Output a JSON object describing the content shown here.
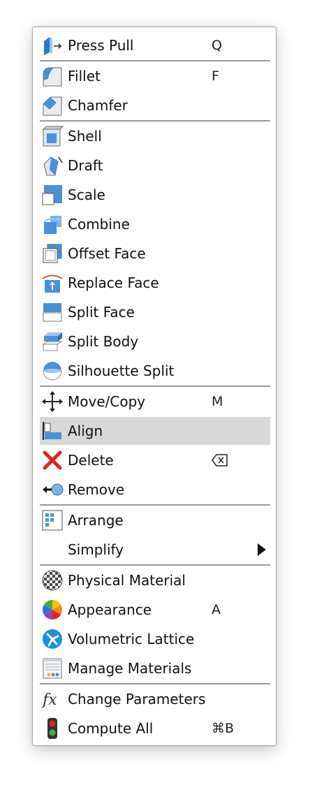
{
  "menu": {
    "items": [
      {
        "label": "Press Pull",
        "shortcut": "Q",
        "icon": "press-pull-icon"
      },
      {
        "label": "Fillet",
        "shortcut": "F",
        "icon": "fillet-icon"
      },
      {
        "label": "Chamfer",
        "icon": "chamfer-icon"
      },
      {
        "label": "Shell",
        "icon": "shell-icon"
      },
      {
        "label": "Draft",
        "icon": "draft-icon"
      },
      {
        "label": "Scale",
        "icon": "scale-icon"
      },
      {
        "label": "Combine",
        "icon": "combine-icon"
      },
      {
        "label": "Offset Face",
        "icon": "offset-face-icon"
      },
      {
        "label": "Replace Face",
        "icon": "replace-face-icon"
      },
      {
        "label": "Split Face",
        "icon": "split-face-icon"
      },
      {
        "label": "Split Body",
        "icon": "split-body-icon"
      },
      {
        "label": "Silhouette Split",
        "icon": "silhouette-split-icon"
      },
      {
        "label": "Move/Copy",
        "shortcut": "M",
        "icon": "move-copy-icon"
      },
      {
        "label": "Align",
        "icon": "align-icon",
        "highlighted": true
      },
      {
        "label": "Delete",
        "icon": "delete-icon",
        "shortcut_icon": "delete-key-icon"
      },
      {
        "label": "Remove",
        "icon": "remove-icon"
      },
      {
        "label": "Arrange",
        "icon": "arrange-icon"
      },
      {
        "label": "Simplify",
        "has_submenu": true,
        "submenu_icon": "submenu-arrow-icon"
      },
      {
        "label": "Physical Material",
        "icon": "physical-material-icon"
      },
      {
        "label": "Appearance",
        "shortcut": "A",
        "icon": "appearance-icon"
      },
      {
        "label": "Volumetric Lattice",
        "icon": "volumetric-lattice-icon"
      },
      {
        "label": "Manage Materials",
        "icon": "manage-materials-icon"
      },
      {
        "label": "Change Parameters",
        "icon": "change-parameters-icon"
      },
      {
        "label": "Compute All",
        "shortcut": "⌘B",
        "icon": "compute-all-icon"
      }
    ]
  },
  "colors": {
    "icon_blue": "#4a90d9",
    "icon_light_blue": "#9cc6ee",
    "highlight": "#d8d8d8",
    "separator": "#9a9a9a",
    "delete_red": "#e0241b"
  }
}
